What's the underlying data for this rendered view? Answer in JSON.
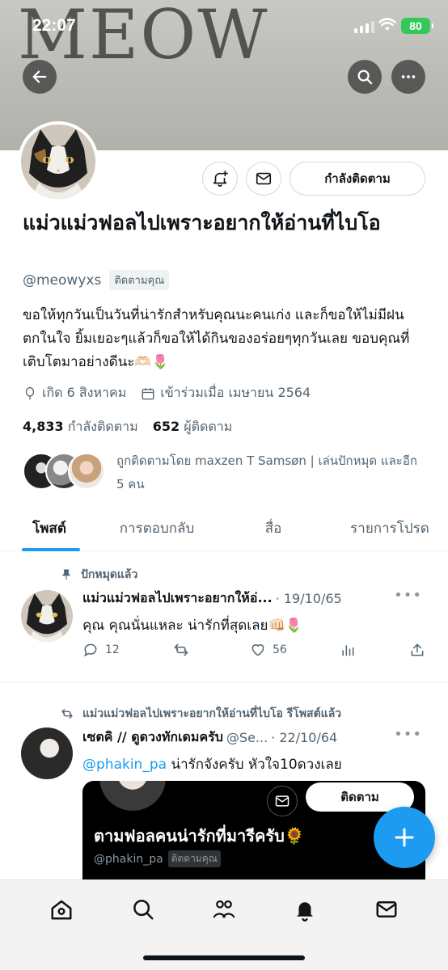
{
  "status_bar": {
    "time": "22:07",
    "battery": "80"
  },
  "banner": {
    "text": "MEOW"
  },
  "profile": {
    "name": "แม่วแม่วฟอลไปเพราะอยากให้อ่านที่ไบโอ",
    "handle": "@meowyxs",
    "follows_you": "ติดตามคุณ",
    "bio": "ขอให้ทุกวันเป็นวันที่น่ารักสำหรับคุณนะคนเก่ง และก็ขอให้ไม่มีฝนตกในใจ ยิ้มเยอะๆแล้วก็ขอให้ได้กินของอร่อยๆทุกวันเลย ขอบคุณที่เติบโตมาอย่างดีนะ🫶🏻🌷",
    "birth": "เกิด 6 สิงหาคม",
    "joined": "เข้าร่วมเมื่อ เมษายน 2564",
    "following_count": "4,833",
    "following_label": "กำลังติดตาม",
    "followers_count": "652",
    "followers_label": "ผู้ติดตาม",
    "followed_by": "ถูกติดตามโดย maxzen T Samsøn | เล่นปักหมุด และอีก 5 คน",
    "following_button": "กำลังติดตาม"
  },
  "tabs": [
    "โพสต์",
    "การตอบกลับ",
    "สื่อ",
    "รายการโปรด"
  ],
  "posts": [
    {
      "context": "ปักหมุดแล้ว",
      "name": "แม่วแม่วฟอลไปเพราะอยากให้อ่...",
      "handle": "",
      "date": "· 19/10/65",
      "text": "คุณ คุณนั่นแหละ น่ารักที่สุดเลย👊🏻🌷",
      "replies": "12",
      "reposts": "",
      "likes": "56"
    },
    {
      "context": "แม่วแม่วฟอลไปเพราะอยากให้อ่านที่ไบโอ รีโพสต์แล้ว",
      "name": "เซตคิ // ดูดวงทักเดมครับ",
      "handle": "@Se...",
      "date": "· 22/10/64",
      "mention": "@phakin_pa",
      "text": " น่ารักจังครับ หัวใจ10ดวงเลย",
      "embed": {
        "follow_button": "ติดตาม",
        "title": "ตามฟอลคนน่ารักที่มารีครับ🌻",
        "handle": "@phakin_pa",
        "follows_you": "ติดตามคุณ"
      }
    }
  ],
  "colors": {
    "accent": "#1d9bf0",
    "text": "#0f1419",
    "muted": "#536471"
  }
}
